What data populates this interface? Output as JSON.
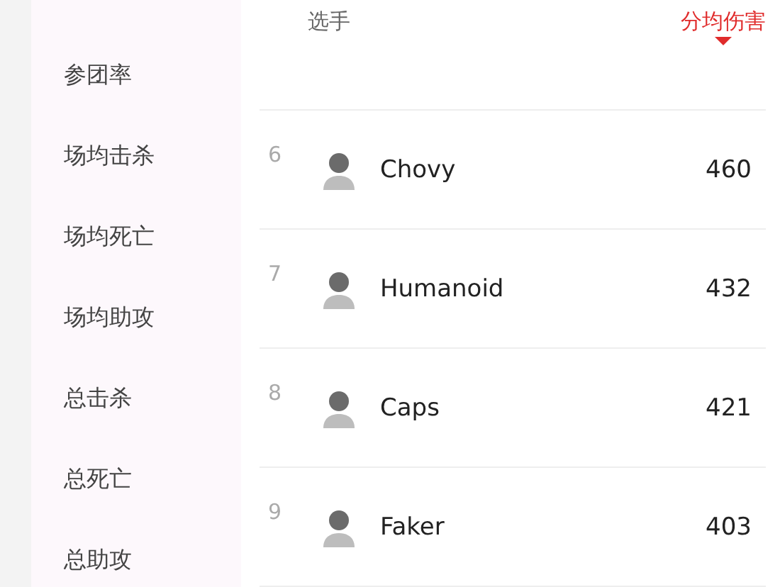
{
  "sidebar": {
    "items": [
      {
        "label": "参团率"
      },
      {
        "label": "场均击杀"
      },
      {
        "label": "场均死亡"
      },
      {
        "label": "场均助攻"
      },
      {
        "label": "总击杀"
      },
      {
        "label": "总死亡"
      },
      {
        "label": "总助攻"
      }
    ]
  },
  "table": {
    "columns": [
      {
        "label": "选手",
        "sorted": false
      },
      {
        "label": "分均伤害",
        "sorted": true
      }
    ],
    "rows": [
      {
        "rank": "6",
        "player": "Chovy",
        "value": "460"
      },
      {
        "rank": "7",
        "player": "Humanoid",
        "value": "432"
      },
      {
        "rank": "8",
        "player": "Caps",
        "value": "421"
      },
      {
        "rank": "9",
        "player": "Faker",
        "value": "403"
      }
    ]
  }
}
